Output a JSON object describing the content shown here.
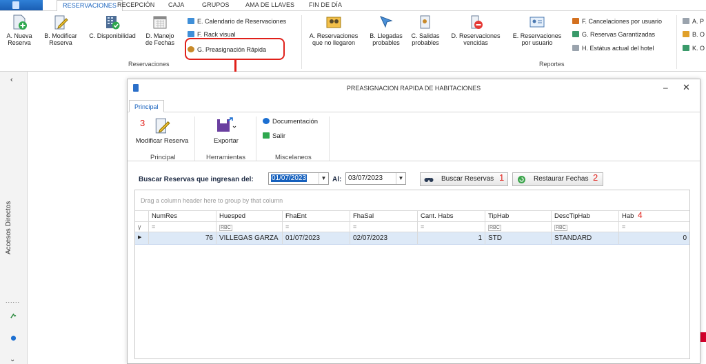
{
  "top_tabs": [
    "RESERVACIONES",
    "RECEPCIÓN",
    "CAJA",
    "GRUPOS",
    "AMA DE LLAVES",
    "FIN DE DÍA"
  ],
  "ribbon": {
    "reservaciones_buttons": [
      {
        "line1": "A. Nueva",
        "line2": "Reserva"
      },
      {
        "line1": "B. Modificar",
        "line2": "Reserva"
      },
      {
        "line1": "C. Disponibilidad",
        "line2": ""
      },
      {
        "line1": "D. Manejo",
        "line2": "de Fechas"
      }
    ],
    "reservaciones_small": [
      "E. Calendario de Reservaciones",
      "F. Rack visual",
      "G. Preasignación Rápida"
    ],
    "reservaciones_group": "Reservaciones",
    "reportes_buttons": [
      {
        "line1": "A. Reservaciones",
        "line2": "que no llegaron"
      },
      {
        "line1": "B. Llegadas",
        "line2": "probables"
      },
      {
        "line1": "C. Salidas",
        "line2": "probables"
      },
      {
        "line1": "D. Reservaciones",
        "line2": "vencidas"
      },
      {
        "line1": "E. Reservaciones",
        "line2": "por usuario"
      }
    ],
    "reportes_small": [
      "F. Cancelaciones por usuario",
      "G. Reservas Garantizadas",
      "H. Estátus actual del hotel"
    ],
    "reportes_small_cut": [
      "A. P",
      "B. O",
      "K. O"
    ],
    "reportes_group": "Reportes"
  },
  "sidebar": {
    "label": "Accesos Directos",
    "dots": "......"
  },
  "dialog": {
    "title": "PREASIGNACION RAPIDA DE HABITACIONES",
    "tab": "Principal",
    "buttons": {
      "modificar": "Modificar Reserva",
      "exportar": "Exportar",
      "documentacion": "Documentación",
      "salir": "Salir"
    },
    "groups": {
      "principal": "Principal",
      "herramientas": "Herramientas",
      "miscelaneos": "Miscelaneos"
    },
    "badges": {
      "b1": "1",
      "b2": "2",
      "b3": "3",
      "b4": "4"
    },
    "search": {
      "label": "Buscar Reservas que ingresan del:",
      "from": "01/07/2023",
      "to_label": "Al:",
      "to": "03/07/2023",
      "search_button": "Buscar Reservas",
      "restore_button": "Restaurar Fechas"
    },
    "grid": {
      "group_hint": "Drag a column header here to group by that column",
      "columns": [
        "NumRes",
        "Huesped",
        "FhaEnt",
        "FhaSal",
        "Cant. Habs",
        "TipHab",
        "DescTipHab",
        "Hab"
      ],
      "filter_eq": "=",
      "filter_abc": "RBC",
      "rows": [
        {
          "NumRes": "76",
          "Huesped": "VILLEGAS  GARZA",
          "FhaEnt": "01/07/2023",
          "FhaSal": "02/07/2023",
          "CantHabs": "1",
          "TipHab": "STD",
          "DescTipHab": "STANDARD",
          "Hab": "0"
        }
      ]
    }
  },
  "colors": {
    "accent": "#1560bd",
    "highlight": "#e0201a"
  }
}
